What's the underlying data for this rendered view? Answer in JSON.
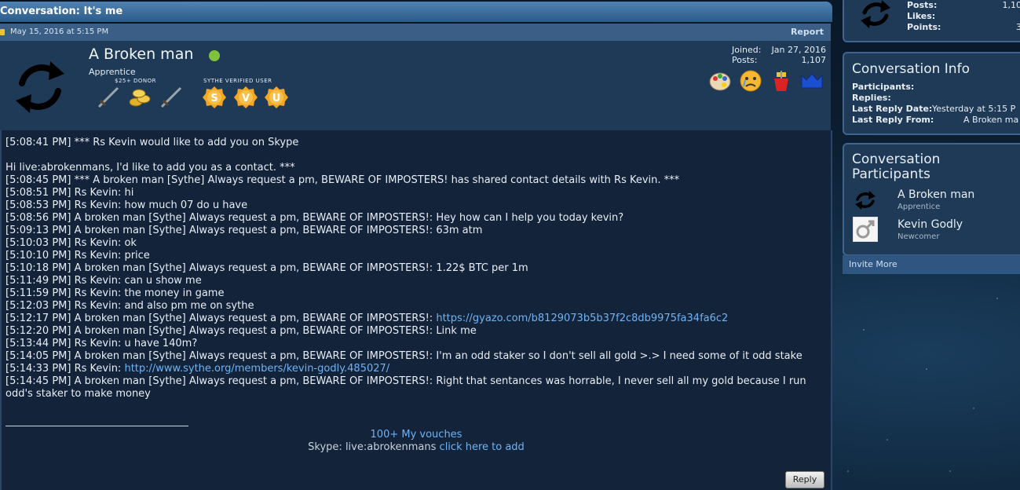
{
  "conversation": {
    "title": "Conversation: It's me",
    "date": "May 15, 2016 at 5:15 PM",
    "report_label": "Report"
  },
  "author": {
    "name": "A Broken man",
    "rank": "Apprentice",
    "donor_label": "$25+ DONOR",
    "verified_label": "SYTHE VERIFIED USER",
    "verified_letters": [
      "S",
      "V",
      "U"
    ],
    "joined_label": "Joined:",
    "joined_value": "Jan 27, 2016",
    "posts_label": "Posts:",
    "posts_value": "1,107"
  },
  "messages": [
    "[5:08:41 PM] *** Rs Kevin would like to add you on Skype",
    "",
    "Hi live:abrokenmans, I'd like to add you as a contact. ***",
    "[5:08:45 PM] *** A broken man [Sythe] Always request a pm, BEWARE OF IMPOSTERS! has shared contact details with Rs Kevin. ***",
    "[5:08:51 PM] Rs Kevin: hi",
    "[5:08:53 PM] Rs Kevin: how much 07 do u have",
    "[5:08:56 PM] A broken man [Sythe] Always request a pm, BEWARE OF IMPOSTERS!: Hey how can I help you today kevin?",
    "[5:09:13 PM] A broken man [Sythe] Always request a pm, BEWARE OF IMPOSTERS!: 63m atm",
    "[5:10:03 PM] Rs Kevin: ok",
    "[5:10:10 PM] Rs Kevin: price",
    "[5:10:18 PM] A broken man [Sythe] Always request a pm, BEWARE OF IMPOSTERS!: 1.22$ BTC per 1m",
    "[5:11:49 PM] Rs Kevin: can u show me",
    "[5:11:59 PM] Rs Kevin: the money in game",
    "[5:12:03 PM] Rs Kevin: and also pm me on sythe"
  ],
  "link_messages": {
    "m1_prefix": "[5:12:17 PM] A broken man [Sythe] Always request a pm, BEWARE OF IMPOSTERS!: ",
    "m1_link": "https://gyazo.com/b8129073b5b37f2c8db9975fa34fa6c2"
  },
  "messages_2": [
    "[5:12:20 PM] A broken man [Sythe] Always request a pm, BEWARE OF IMPOSTERS!: Link me",
    "[5:13:44 PM] Rs Kevin: u have 140m?",
    "[5:14:05 PM] A broken man [Sythe] Always request a pm, BEWARE OF IMPOSTERS!: I'm an odd staker so I don't sell all gold >.> I need some of it odd stake"
  ],
  "link_messages_2": {
    "m2_prefix": "[5:14:33 PM] Rs Kevin: ",
    "m2_link": "http://www.sythe.org/members/kevin-godly.485027/"
  },
  "messages_3": [
    "[5:14:45 PM] A broken man [Sythe] Always request a pm, BEWARE OF IMPOSTERS!: Right that sentances was horrable, I never sell all my gold because I run odd's staker to make money"
  ],
  "signature": {
    "vouches": "100+ My vouches",
    "skype_prefix": "Skype: live:abrokenmans ",
    "skype_link": "click here to add"
  },
  "reply_label": "Reply",
  "sidebar": {
    "stats": {
      "posts_label": "Posts:",
      "posts_value": "1,10",
      "likes_label": "Likes:",
      "points_label": "Points:",
      "points_value": "3"
    },
    "info": {
      "title": "Conversation Info",
      "participants_label": "Participants:",
      "replies_label": "Replies:",
      "last_reply_date_label": "Last Reply Date:",
      "last_reply_date_value": "Yesterday at 5:15 P",
      "last_reply_from_label": "Last Reply From:",
      "last_reply_from_value": "A Broken ma"
    },
    "participants": {
      "title": "Conversation Participants",
      "list": [
        {
          "name": "A Broken man",
          "rank": "Apprentice"
        },
        {
          "name": "Kevin Godly",
          "rank": "Newcomer"
        }
      ]
    },
    "invite_label": "Invite More"
  },
  "colors": {
    "title_bar": "#3d6e9f",
    "panel": "#1f3a57",
    "link": "#6fb3f5",
    "online": "#7ec23b"
  }
}
